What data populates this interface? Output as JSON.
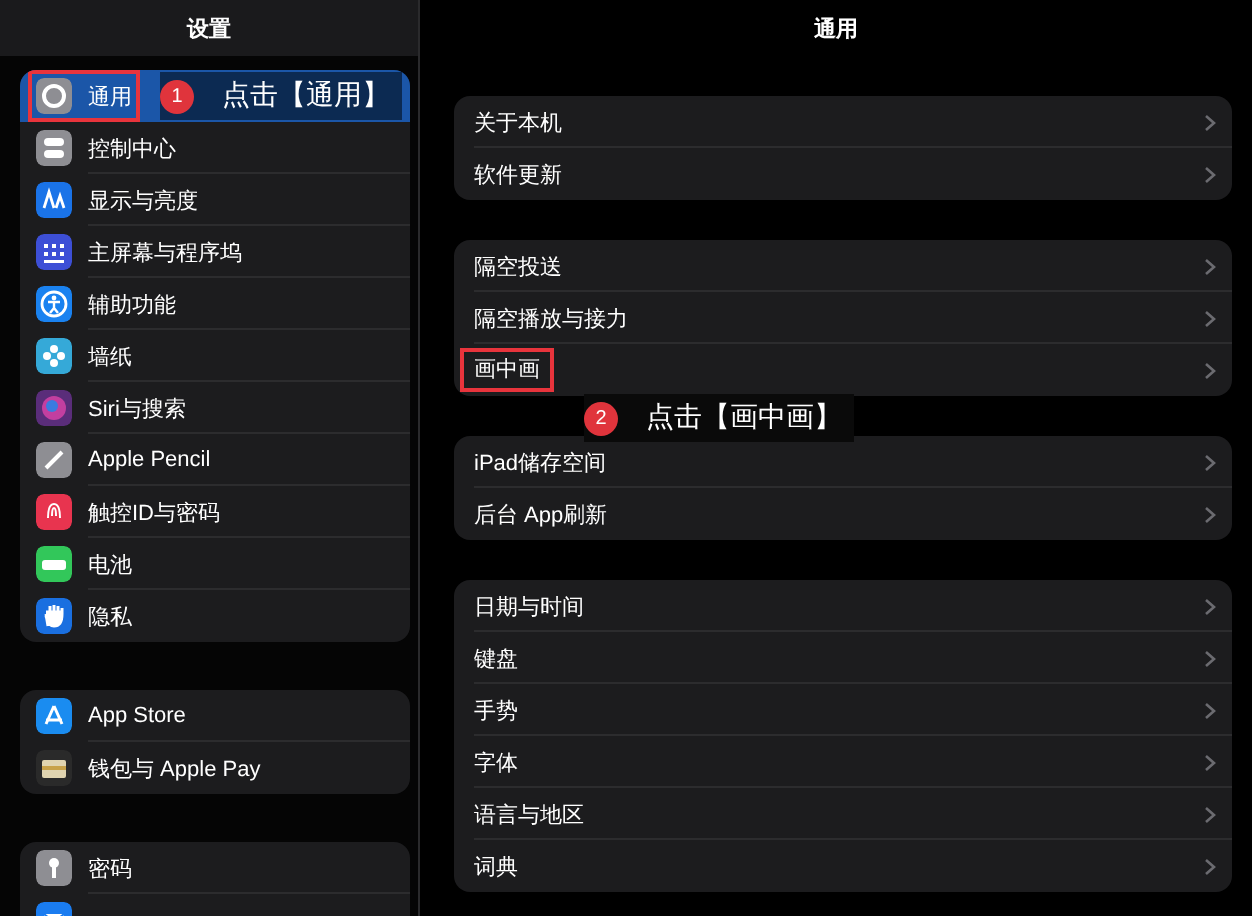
{
  "sidebar": {
    "title": "设置",
    "groups": [
      {
        "items": [
          {
            "label": "通用",
            "color": "#8e8e93",
            "selected": true,
            "highlighted": true
          },
          {
            "label": "控制中心",
            "color": "#8e8e93",
            "selected": false,
            "highlighted": false
          },
          {
            "label": "显示与亮度",
            "color": "#1a73e8",
            "selected": false,
            "highlighted": false
          },
          {
            "label": "主屏幕与程序坞",
            "color": "#3d4fd6",
            "selected": false,
            "highlighted": false
          },
          {
            "label": "辅助功能",
            "color": "#1a82f0",
            "selected": false,
            "highlighted": false
          },
          {
            "label": "墙纸",
            "color": "#35a9d8",
            "selected": false,
            "highlighted": false
          },
          {
            "label": "Siri与搜索",
            "color": "#5a2d7a",
            "selected": false,
            "highlighted": false
          },
          {
            "label": "Apple Pencil",
            "color": "#8e8e93",
            "selected": false,
            "highlighted": false
          },
          {
            "label": "触控ID与密码",
            "color": "#e8344f",
            "selected": false,
            "highlighted": false
          },
          {
            "label": "电池",
            "color": "#32c75a",
            "selected": false,
            "highlighted": false
          },
          {
            "label": "隐私",
            "color": "#1a6fe0",
            "selected": false,
            "highlighted": false
          }
        ]
      },
      {
        "items": [
          {
            "label": "App Store",
            "color": "#1a8cf0",
            "selected": false,
            "highlighted": false
          },
          {
            "label": "钱包与 Apple Pay",
            "color": "#2a2a2a",
            "selected": false,
            "highlighted": false
          }
        ]
      },
      {
        "items": [
          {
            "label": "密码",
            "color": "#8e8e93",
            "selected": false,
            "highlighted": false
          },
          {
            "color": "#1a7cf0",
            "selected": false,
            "highlighted": false
          }
        ]
      }
    ]
  },
  "detail": {
    "title": "通用",
    "groups": [
      {
        "items": [
          {
            "label": "关于本机",
            "highlighted": false
          },
          {
            "label": "软件更新",
            "highlighted": false
          }
        ]
      },
      {
        "items": [
          {
            "label": "隔空投送",
            "highlighted": false
          },
          {
            "label": "隔空播放与接力",
            "highlighted": false
          },
          {
            "label": "画中画",
            "highlighted": true
          }
        ]
      },
      {
        "items": [
          {
            "label": "iPad储存空间",
            "highlighted": false
          },
          {
            "label": "后台 App刷新",
            "highlighted": false
          }
        ]
      },
      {
        "items": [
          {
            "label": "日期与时间",
            "highlighted": false
          },
          {
            "label": "键盘",
            "highlighted": false
          },
          {
            "label": "手势",
            "highlighted": false
          },
          {
            "label": "字体",
            "highlighted": false
          },
          {
            "label": "语言与地区",
            "highlighted": false
          },
          {
            "label": "词典",
            "highlighted": false
          }
        ]
      }
    ]
  },
  "annotations": [
    {
      "number": "1",
      "text": "点击【通用】"
    },
    {
      "number": "2",
      "text": "点击【画中画】"
    }
  ]
}
